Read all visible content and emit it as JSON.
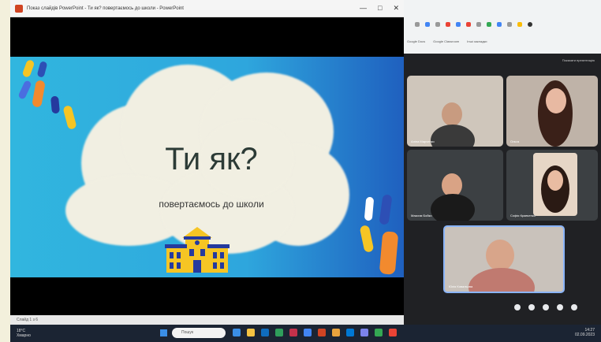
{
  "powerpoint": {
    "window_title": "Показ слайдів PowerPoint - Ти як? повертаємось до школи - PowerPoint",
    "controls": {
      "minimize": "—",
      "maximize": "□",
      "close": "✕"
    },
    "slide": {
      "title": "Ти як?",
      "subtitle": "повертаємось до школи"
    },
    "status": "Слайд 1 з 6"
  },
  "meet": {
    "header_button": "Показати презентацію",
    "participants": [
      {
        "name": "Аліна Марченко"
      },
      {
        "name": "Ольга"
      },
      {
        "name": "Максим Бойко"
      },
      {
        "name": "Софія Кравченко"
      },
      {
        "name": "Юлія Ковальова"
      }
    ],
    "bookmarks": [
      "Google Docs",
      "Google Classroom",
      "Інші закладки"
    ]
  },
  "taskbar": {
    "weather_temp": "18°C",
    "weather_desc": "Хмарно",
    "search_placeholder": "Пошук",
    "time": "14:27",
    "date": "02.09.2023"
  },
  "colors": {
    "slide_blue": "#2ea6dd",
    "cloud": "#f1efe2",
    "meet_bg": "#202124",
    "ppt_accent": "#d04423"
  }
}
